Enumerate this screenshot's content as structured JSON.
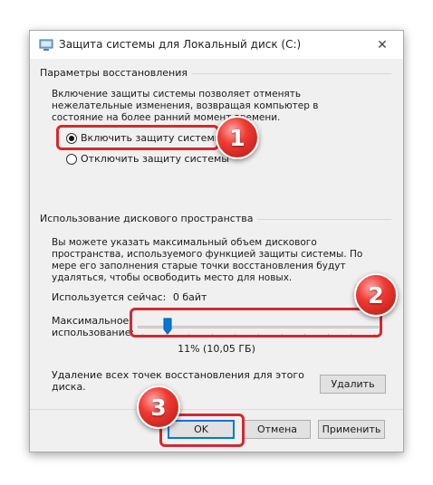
{
  "window": {
    "title": "Защита системы для Локальный диск (C:)",
    "close_glyph": "✕"
  },
  "restore": {
    "legend": "Параметры восстановления",
    "description": "Включение защиты системы позволяет отменять нежелательные изменения, возвращая компьютер в состояние на более ранний момент времени.",
    "option_enable": "Включить защиту системы",
    "option_disable": "Отключить защиту системы",
    "selected": "enable"
  },
  "disk": {
    "legend": "Использование дискового пространства",
    "description": "Вы можете указать максимальный объем дискового пространства, используемого функцией защиты системы. По мере его заполнения старые точки восстановления будут удаляться, чтобы освободить место для новых.",
    "current_usage_label": "Используется сейчас:",
    "current_usage_value": "0 байт",
    "max_usage_label_line1": "Максимальное",
    "max_usage_label_line2": "использование:",
    "slider_percent": 11,
    "slider_value_text": "11% (10,05 ГБ)"
  },
  "delete": {
    "text": "Удаление всех точек восстановления для этого диска.",
    "button": "Удалить"
  },
  "footer": {
    "ok": "OK",
    "cancel": "Отмена",
    "apply": "Применить"
  },
  "annotations": {
    "badge1": "1",
    "badge2": "2",
    "badge3": "3",
    "color": "#d5282f"
  },
  "colors": {
    "accent_blue": "#0078d7",
    "highlight_red": "#d5282f"
  }
}
